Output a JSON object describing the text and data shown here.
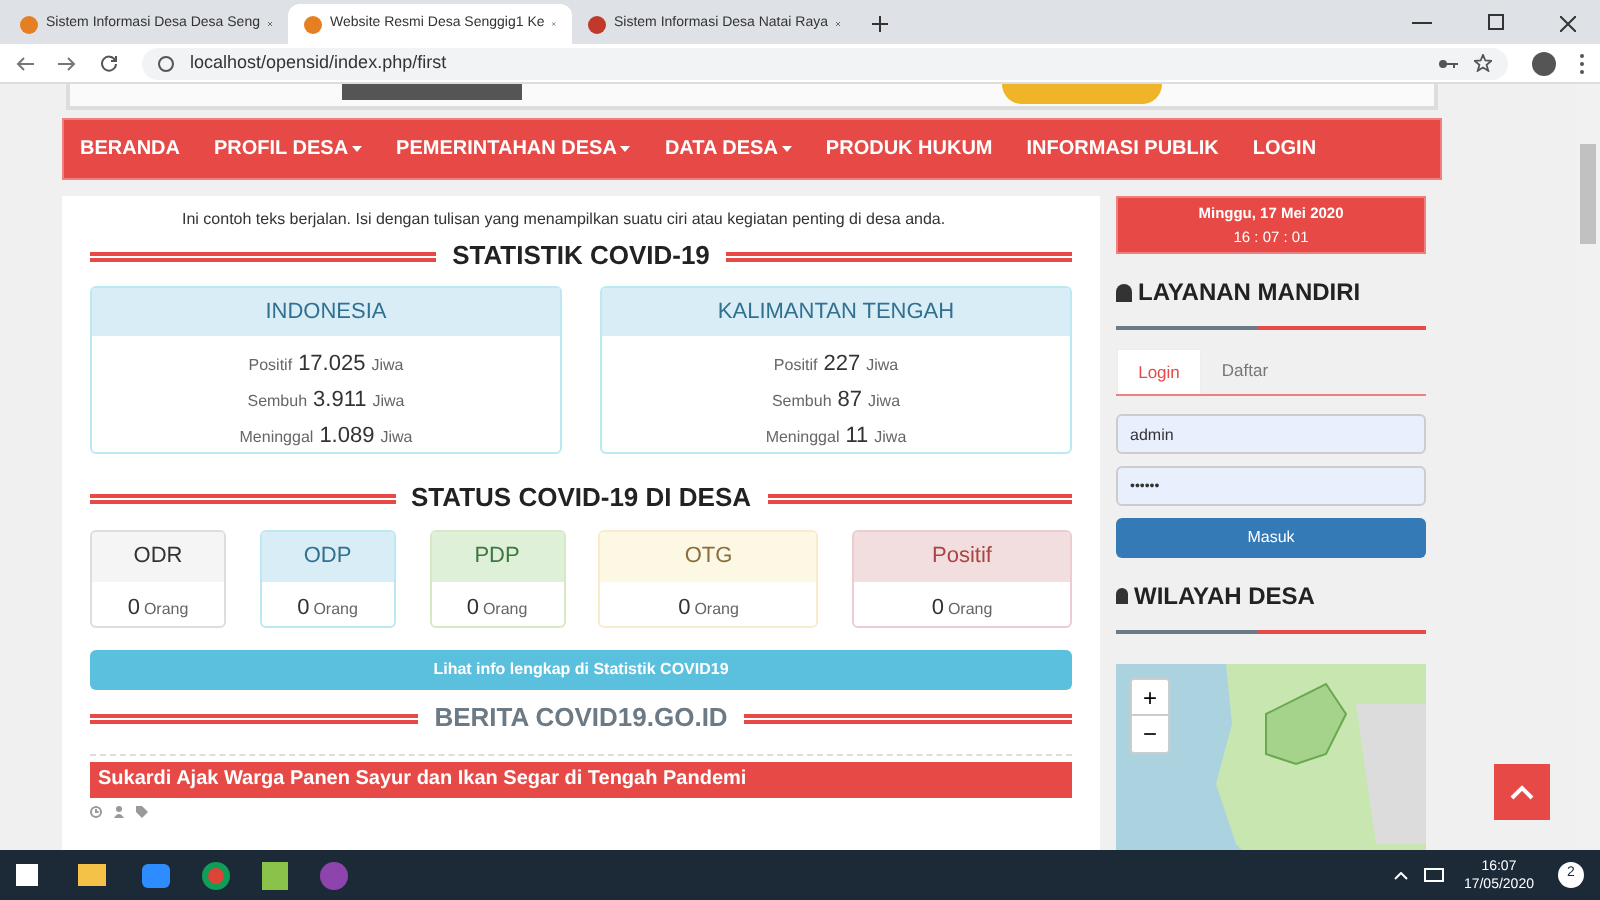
{
  "browser": {
    "tabs": [
      {
        "title": "Sistem Informasi Desa Desa Seng",
        "selected": false
      },
      {
        "title": "Website Resmi Desa Senggig1 Ke",
        "selected": true
      },
      {
        "title": "Sistem Informasi Desa Natai Raya",
        "selected": false
      }
    ],
    "url": "localhost/opensid/index.php/first"
  },
  "nav": [
    {
      "label": "BERANDA",
      "dropdown": false
    },
    {
      "label": "PROFIL DESA",
      "dropdown": true
    },
    {
      "label": "PEMERINTAHAN DESA",
      "dropdown": true
    },
    {
      "label": "DATA DESA",
      "dropdown": true
    },
    {
      "label": "PRODUK HUKUM",
      "dropdown": false
    },
    {
      "label": "INFORMASI PUBLIK",
      "dropdown": false
    },
    {
      "label": "LOGIN",
      "dropdown": false
    }
  ],
  "marquee": "Ini contoh teks berjalan. Isi dengan tulisan yang menampilkan suatu ciri atau kegiatan penting di desa anda.",
  "stats": {
    "title": "STATISTIK COVID-19",
    "regions": [
      {
        "name": "INDONESIA",
        "rows": [
          {
            "label": "Positif",
            "value": "17.025",
            "unit": "Jiwa"
          },
          {
            "label": "Sembuh",
            "value": "3.911",
            "unit": "Jiwa"
          },
          {
            "label": "Meninggal",
            "value": "1.089",
            "unit": "Jiwa"
          }
        ]
      },
      {
        "name": "KALIMANTAN TENGAH",
        "rows": [
          {
            "label": "Positif",
            "value": "227",
            "unit": "Jiwa"
          },
          {
            "label": "Sembuh",
            "value": "87",
            "unit": "Jiwa"
          },
          {
            "label": "Meninggal",
            "value": "11",
            "unit": "Jiwa"
          }
        ]
      }
    ]
  },
  "status": {
    "title": "STATUS COVID-19 DI DESA",
    "cards": [
      {
        "label": "ODR",
        "value": "0",
        "unit": "Orang",
        "kind": "default"
      },
      {
        "label": "ODP",
        "value": "0",
        "unit": "Orang",
        "kind": "info"
      },
      {
        "label": "PDP",
        "value": "0",
        "unit": "Orang",
        "kind": "success"
      },
      {
        "label": "OTG",
        "value": "0",
        "unit": "Orang",
        "kind": "warning"
      },
      {
        "label": "Positif",
        "value": "0",
        "unit": "Orang",
        "kind": "danger"
      }
    ]
  },
  "info_button": "Lihat info lengkap di Statistik COVID19",
  "news": {
    "title": "BERITA COVID19.GO.ID",
    "headline": "Sukardi Ajak Warga Panen Sayur dan Ikan Segar di Tengah Pandemi"
  },
  "sidebar": {
    "date": "Minggu, 17 Mei 2020",
    "time": "16 : 07 : 01",
    "login_title": "LAYANAN MANDIRI",
    "tabs": [
      {
        "label": "Login",
        "selected": true
      },
      {
        "label": "Daftar",
        "selected": false
      }
    ],
    "username": "admin",
    "password": "••••••",
    "submit": "Masuk",
    "map_title": "WILAYAH DESA",
    "zoom_in": "+",
    "zoom_out": "−"
  },
  "taskbar": {
    "time": "16:07",
    "date": "17/05/2020",
    "notifications": "2"
  }
}
